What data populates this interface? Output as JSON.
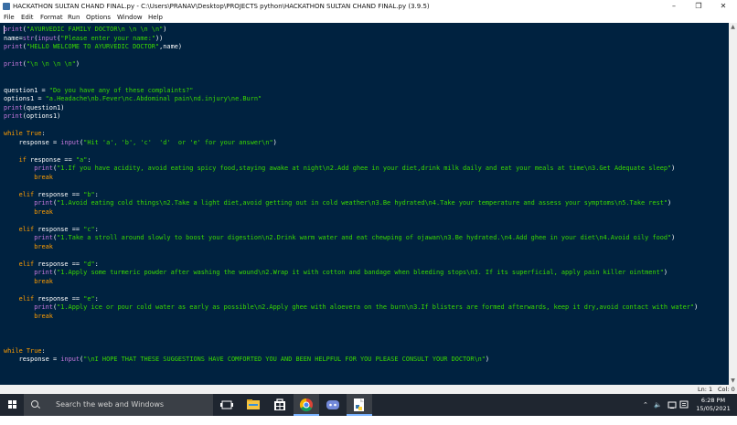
{
  "window": {
    "title": "HACKATHON SULTAN CHAND FINAL.py - C:\\Users\\PRANAV\\Desktop\\PROJECTS python\\HACKATHON SULTAN CHAND FINAL.py (3.9.5)",
    "minimize": "–",
    "maximize": "❐",
    "close": "✕"
  },
  "menu": [
    "File",
    "Edit",
    "Format",
    "Run",
    "Options",
    "Window",
    "Help"
  ],
  "editor": {
    "lines": [
      "print(\"AYURVEDIC FAMILY DOCTOR\\n \\n \\n \\n\")",
      "name=str(input(\"Please enter your name:\"))",
      "print(\"HELLO WELCOME TO AYURVEDIC DOCTOR\",name)",
      "",
      "print(\"\\n \\n \\n \\n\")",
      "",
      "",
      "question1 = \"Do you have any of these complaints?\"",
      "options1 = \"a.Headache\\nb.Fever\\nc.Abdominal pain\\nd.injury\\ne.Burn\"",
      "print(question1)",
      "print(options1)",
      "",
      "while True:",
      "    response = input(\"Hit 'a', 'b', 'c'  'd'  or 'e' for your answer\\n\")",
      "",
      "    if response == \"a\":",
      "        print(\"1.If you have acidity, avoid eating spicy food,staying awake at night\\n2.Add ghee in your diet,drink milk daily and eat your meals at time\\n3.Get Adequate sleep\")",
      "        break",
      "",
      "    elif response == \"b\":",
      "        print(\"1.Avoid eating cold things\\n2.Take a light diet,avoid getting out in cold weather\\n3.Be hydrated\\n4.Take your temperature and assess your symptoms\\n5.Take rest\")",
      "        break",
      "",
      "    elif response == \"c\":",
      "        print(\"1.Take a stroll around slowly to boost your digestion\\n2.Drink warm water and eat chewping of ojawan\\n3.Be hydrated.\\n4.Add ghee in your diet\\n4.Avoid oily food\")",
      "        break",
      "",
      "    elif response == \"d\":",
      "        print(\"1.Apply some turmeric powder after washing the wound\\n2.Wrap it with cotton and bandage when bleeding stops\\n3. If its superficial, apply pain killer ointment\")",
      "        break",
      "",
      "    elif response == \"e\":",
      "        print(\"1.Apply ice or pour cold water as early as possible\\n2.Apply ghee with aloevera on the burn\\n3.If blisters are formed afterwards, keep it dry,avoid contact with water\")",
      "        break",
      "",
      "",
      "",
      "while True:",
      "    response = input(\"\\nI HOPE THAT THESE SUGGESTIONS HAVE COMFORTED YOU AND BEEN HELPFUL FOR YOU PLEASE CONSULT YOUR DOCTOR\\n\")"
    ]
  },
  "status": {
    "ln": "Ln: 1",
    "col": "Col: 0"
  },
  "taskbar": {
    "search_placeholder": "Search the web and Windows",
    "time": "6:28 PM",
    "date": "15/05/2021",
    "icons": [
      "task-view-icon",
      "file-explorer-icon",
      "store-icon",
      "chrome-icon",
      "discord-icon",
      "python-idle-icon"
    ]
  },
  "colors": {
    "editor_bg": "#002240",
    "keyword": "#ff9d00",
    "builtin": "#c678dd",
    "string": "#3ad900",
    "taskbar_bg": "#1f2630"
  }
}
